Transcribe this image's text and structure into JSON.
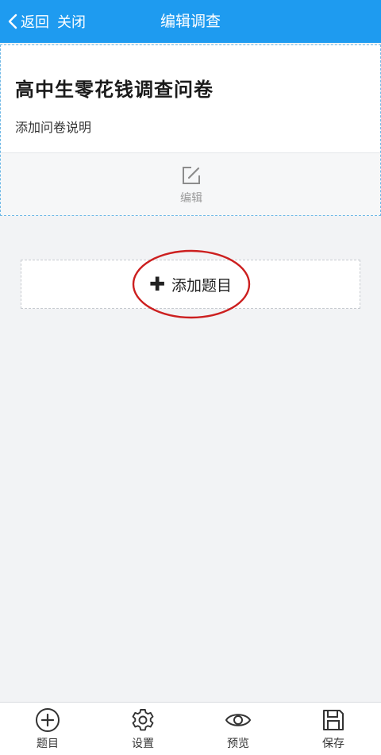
{
  "header": {
    "back_label": "返回",
    "close_label": "关闭",
    "title": "编辑调查",
    "background_color": "#1e9bf0"
  },
  "survey": {
    "title": "高中生零花钱调查问卷",
    "description": "添加问卷说明",
    "edit_label": "编辑",
    "edit_icon": "edit-icon"
  },
  "add_question": {
    "plus_icon": "plus-icon",
    "label": "添加题目",
    "annotation_color": "#cc1f1f"
  },
  "tabbar": {
    "items": [
      {
        "label": "题目",
        "icon": "plus-circle-icon"
      },
      {
        "label": "设置",
        "icon": "gear-icon"
      },
      {
        "label": "预览",
        "icon": "eye-icon"
      },
      {
        "label": "保存",
        "icon": "save-icon"
      }
    ]
  }
}
